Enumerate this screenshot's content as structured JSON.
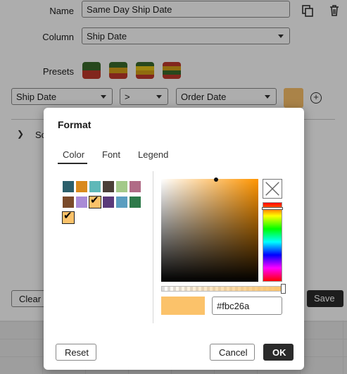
{
  "form": {
    "name_label": "Name",
    "name_value": "Same Day Ship Date",
    "column_label": "Column",
    "column_value": "Ship Date",
    "presets_label": "Presets",
    "presets": [
      {
        "colors": [
          "#3a6b2b",
          "#c0392b"
        ]
      },
      {
        "colors": [
          "#3a6b2b",
          "#d4a017",
          "#c0392b"
        ]
      },
      {
        "colors": [
          "#3a6b2b",
          "#e6c619",
          "#d4a017",
          "#c0392b"
        ]
      },
      {
        "colors": [
          "#c0392b",
          "#d4a017",
          "#3a6b2b",
          "#c0392b"
        ]
      }
    ],
    "condition": {
      "left_value": "Ship Date",
      "operator": ">",
      "right_value": "Order Date",
      "format_color": "#fbc26a"
    },
    "collapsed_row_text": "Sc",
    "clear_label": "Clear",
    "save_label": "Save"
  },
  "dialog": {
    "title": "Format",
    "tabs": [
      {
        "label": "Color",
        "active": true
      },
      {
        "label": "Font",
        "active": false
      },
      {
        "label": "Legend",
        "active": false
      }
    ],
    "palette": [
      {
        "color": "#2b5f6b",
        "selected": false
      },
      {
        "color": "#d98a1c",
        "selected": false
      },
      {
        "color": "#5fb8b8",
        "selected": false
      },
      {
        "color": "#4a3f38",
        "selected": false
      },
      {
        "color": "#a3c98a",
        "selected": false
      },
      {
        "color": "#b06b86",
        "selected": false
      },
      {
        "color": "#7a4a2a",
        "selected": false
      },
      {
        "color": "#a98bd6",
        "selected": false
      },
      {
        "color": "#fbc26a",
        "selected": true
      },
      {
        "color": "#5a3a7a",
        "selected": false
      },
      {
        "color": "#5a9ec0",
        "selected": false
      },
      {
        "color": "#2e7a4a",
        "selected": false
      },
      {
        "color": "#fbc26a",
        "selected": true
      }
    ],
    "current_color": "#fbc26a",
    "hex_value": "#fbc26a",
    "reset_label": "Reset",
    "cancel_label": "Cancel",
    "ok_label": "OK"
  }
}
